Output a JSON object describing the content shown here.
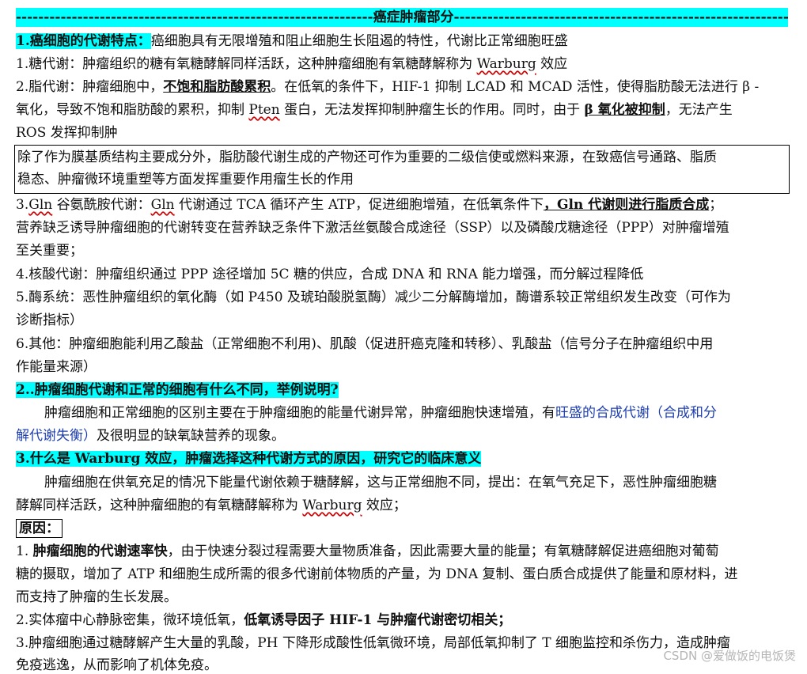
{
  "banner": "----------------------------------------------------------------癌症肿瘤部分-----------------------------------------------------------------------------------------",
  "s1": {
    "title": "1.癌细胞的代谢特点：",
    "text": "癌细胞具有无限增殖和阻止细胞生长阻遏的特性，代谢比正常细胞旺盛"
  },
  "l1": {
    "a": "1.糖代谢：肿瘤组织的糖有氧糖酵解同样活跃，这种肿瘤细胞有氧糖酵解称为 ",
    "w": "Warburg",
    "b": " 效应"
  },
  "l2": {
    "a": "2.脂代谢：肿瘤细胞中，",
    "bold": "不饱和脂肪酸累积",
    "c": "。在低氧的条件下，HIF-1 抑制 LCAD 和 MCAD 活性，使得脂肪酸无法进行 β -"
  },
  "l3": {
    "a": "氧化，导致不饱和脂肪酸的累积，抑制 ",
    "w": "Pten",
    "b": " 蛋白，无法发挥抑制肿瘤生长的作用。同时，由于 ",
    "bold": "β 氧化被抑制",
    "c": "，无法产生"
  },
  "l4": "ROS 发挥抑制肿",
  "box": {
    "l1": "除了作为膜基质结构主要成分外，脂肪酸代谢生成的产物还可作为重要的二级信使或燃料来源，在致癌信号通路、脂质",
    "l2": "稳态、肿瘤微环境重塑等方面发挥重要作用瘤生长的作用"
  },
  "l5": {
    "w1": "Gln",
    "a": "3.",
    "b": " 谷氨酰胺代谢：",
    "w2": "Gln",
    "c": " 代谢通过 TCA 循环产生 ATP，促进细胞增殖，在低氧条件下",
    "bold": "，Gln 代谢则进行脂质合成",
    "d": "；"
  },
  "l6": "营养缺乏诱导肿瘤细胞的代谢转变在营养缺乏条件下激活丝氨酸合成途径（SSP）以及磷酸戊糖途径（PPP）对肿瘤增殖",
  "l7": "至关重要；",
  "l8": "4.核酸代谢：肿瘤组织通过 PPP 途径增加 5C 糖的供应，合成 DNA 和 RNA 能力增强，而分解过程降低",
  "l9": "5.酶系统：恶性肿瘤组织的氧化酶（如 P450 及琥珀酸脱氢酶）减少二分解酶增加，酶谱系较正常组织发生改变（可作为",
  "l10": "诊断指标）",
  "l11": "6.其他：肿瘤细胞能利用乙酸盐（正常细胞不利用)、肌酸（促进肝癌克隆和转移）、乳酸盐（信号分子在肿瘤组织中用",
  "l12": "作能量来源）",
  "s2": {
    "title": "2..肿瘤细胞代谢和正常的细胞有什么不同，举例说明?"
  },
  "p2": {
    "a": "肿瘤细胞和正常细胞的区别主要在于肿瘤细胞的能量代谢异常，肿瘤细胞快速增殖，有",
    "blue1": "旺盛的合成代谢（合成和分",
    "blue2": "解代谢失衡）",
    "b": "及很明显的缺氧缺营养的现象。"
  },
  "s3": {
    "title": "3.什么是 Warburg 效应，肿瘤选择这种代谢方式的原因，研究它的临床意义"
  },
  "p3": {
    "l1": "肿瘤细胞在供氧充足的情况下能量代谢依赖于糖酵解，这与正常细胞不同，提出：在氧气充足下，恶性肿瘤细胞糖",
    "l2a": "酵解同样活跃，这种肿瘤细胞的有氧糖酵解称为 ",
    "w": "Warburg",
    "l2b": " 效应；"
  },
  "reason": "原因：",
  "r1": {
    "num": "1.  ",
    "bold": "肿瘤细胞的代谢速率快",
    "a": "，由于快速分裂过程需要大量物质准备，因此需要大量的能量；有氧糖酵解促进癌细胞对葡萄"
  },
  "r1b": "糖的摄取，增加了 ATP 和细胞生成所需的很多代谢前体物质的产量，为 DNA 复制、蛋白质合成提供了能量和原材料，进",
  "r1c": "而支持了肿瘤的生长发展。",
  "r2": {
    "a": "2.实体瘤中心静脉密集，微环境低氧，",
    "bold": "低氧诱导因子 HIF-1 与肿瘤代谢密切相关；"
  },
  "r3": "3.肿瘤细胞通过糖酵解产生大量的乳酸，PH 下降形成酸性低氧微环境，局部低氧抑制了 T 细胞监控和杀伤力，造成肿瘤",
  "r3b": "免疫逃逸，从而影响了机体免疫。",
  "watermark": "CSDN @爱做饭的电饭煲"
}
